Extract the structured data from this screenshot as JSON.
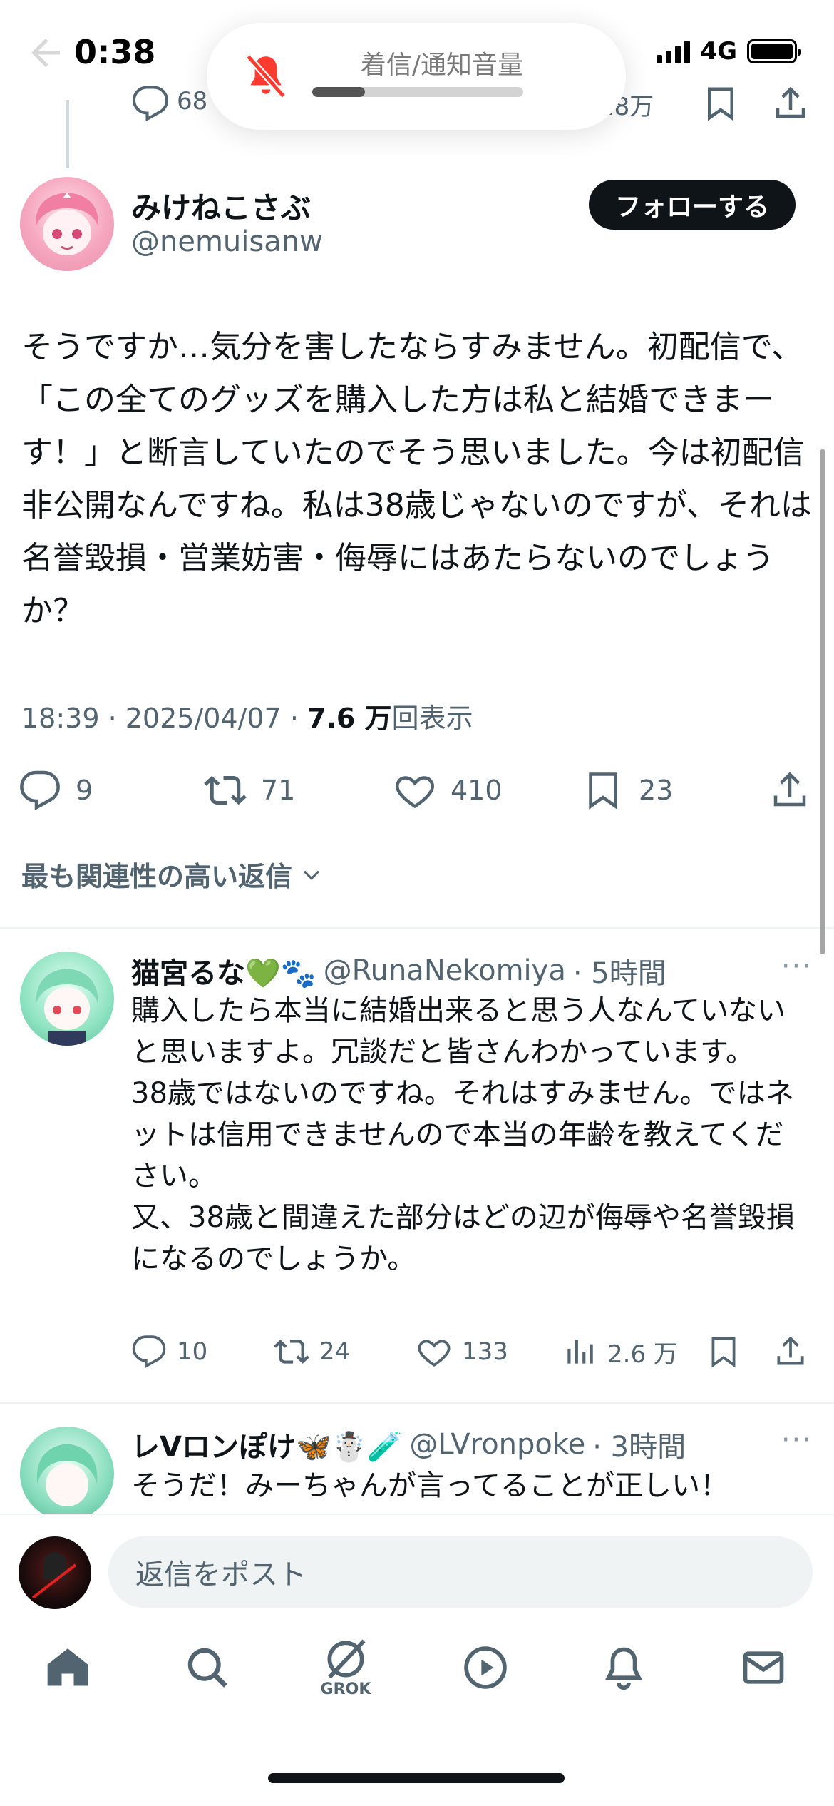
{
  "status_bar": {
    "time": "0:38",
    "network": "4G"
  },
  "volume_hud": {
    "title": "着信/通知音量",
    "level": 0.25
  },
  "previous_tweet": {
    "reply_count": "68",
    "view_count": "18万"
  },
  "tweet": {
    "author_name": "みけねこさぶ",
    "author_handle": "@nemuisanw",
    "follow_label": "フォローする",
    "text": "そうですか…気分を害したならすみません。初配信で、「この全てのグッズを購入した方は私と結婚できまーす！」と断言していたのでそう思いました。今は初配信非公開なんですね。私は38歳じゃないのですが、それは名誉毀損・営業妨害・侮辱にはあたらないのでしょうか？",
    "meta_time": "18:39 · 2025/04/07 · ",
    "meta_views": "7.6 万",
    "meta_views_suffix": "回表示",
    "replies": "9",
    "retweets": "71",
    "likes": "410",
    "bookmarks": "23"
  },
  "sort_label": "最も関連性の高い返信",
  "replies": [
    {
      "name": "猫宮るな💚🐾",
      "handle": "@RunaNekomiya",
      "time": "· 5時間",
      "more": "···",
      "text": "購入したら本当に結婚出来ると思う人なんていないと思いますよ。冗談だと皆さんわかっています。\n38歳ではないのですね。それはすみません。ではネットは信用できませんので本当の年齢を教えてください。\n又、38歳と間違えた部分はどの辺が侮辱や名誉毀損になるのでしょうか。",
      "reply_count": "10",
      "retweet_count": "24",
      "like_count": "133",
      "view_count": "2.6 万"
    },
    {
      "name": "レVロンぽけ🦋☃️🧪",
      "handle": "@LVronpoke",
      "time": "· 3時間",
      "more": "···",
      "text": "そうだ！みーちゃんが言ってることが正しい！"
    }
  ],
  "compose": {
    "placeholder": "返信をポスト"
  },
  "tabbar": {
    "grok_label": "GROK"
  },
  "colors": {
    "text": "#0f1419",
    "secondary": "#536471",
    "follow_bg": "#0f1419",
    "divider": "#eff3f4",
    "muted_bell": "#ff3b30"
  }
}
